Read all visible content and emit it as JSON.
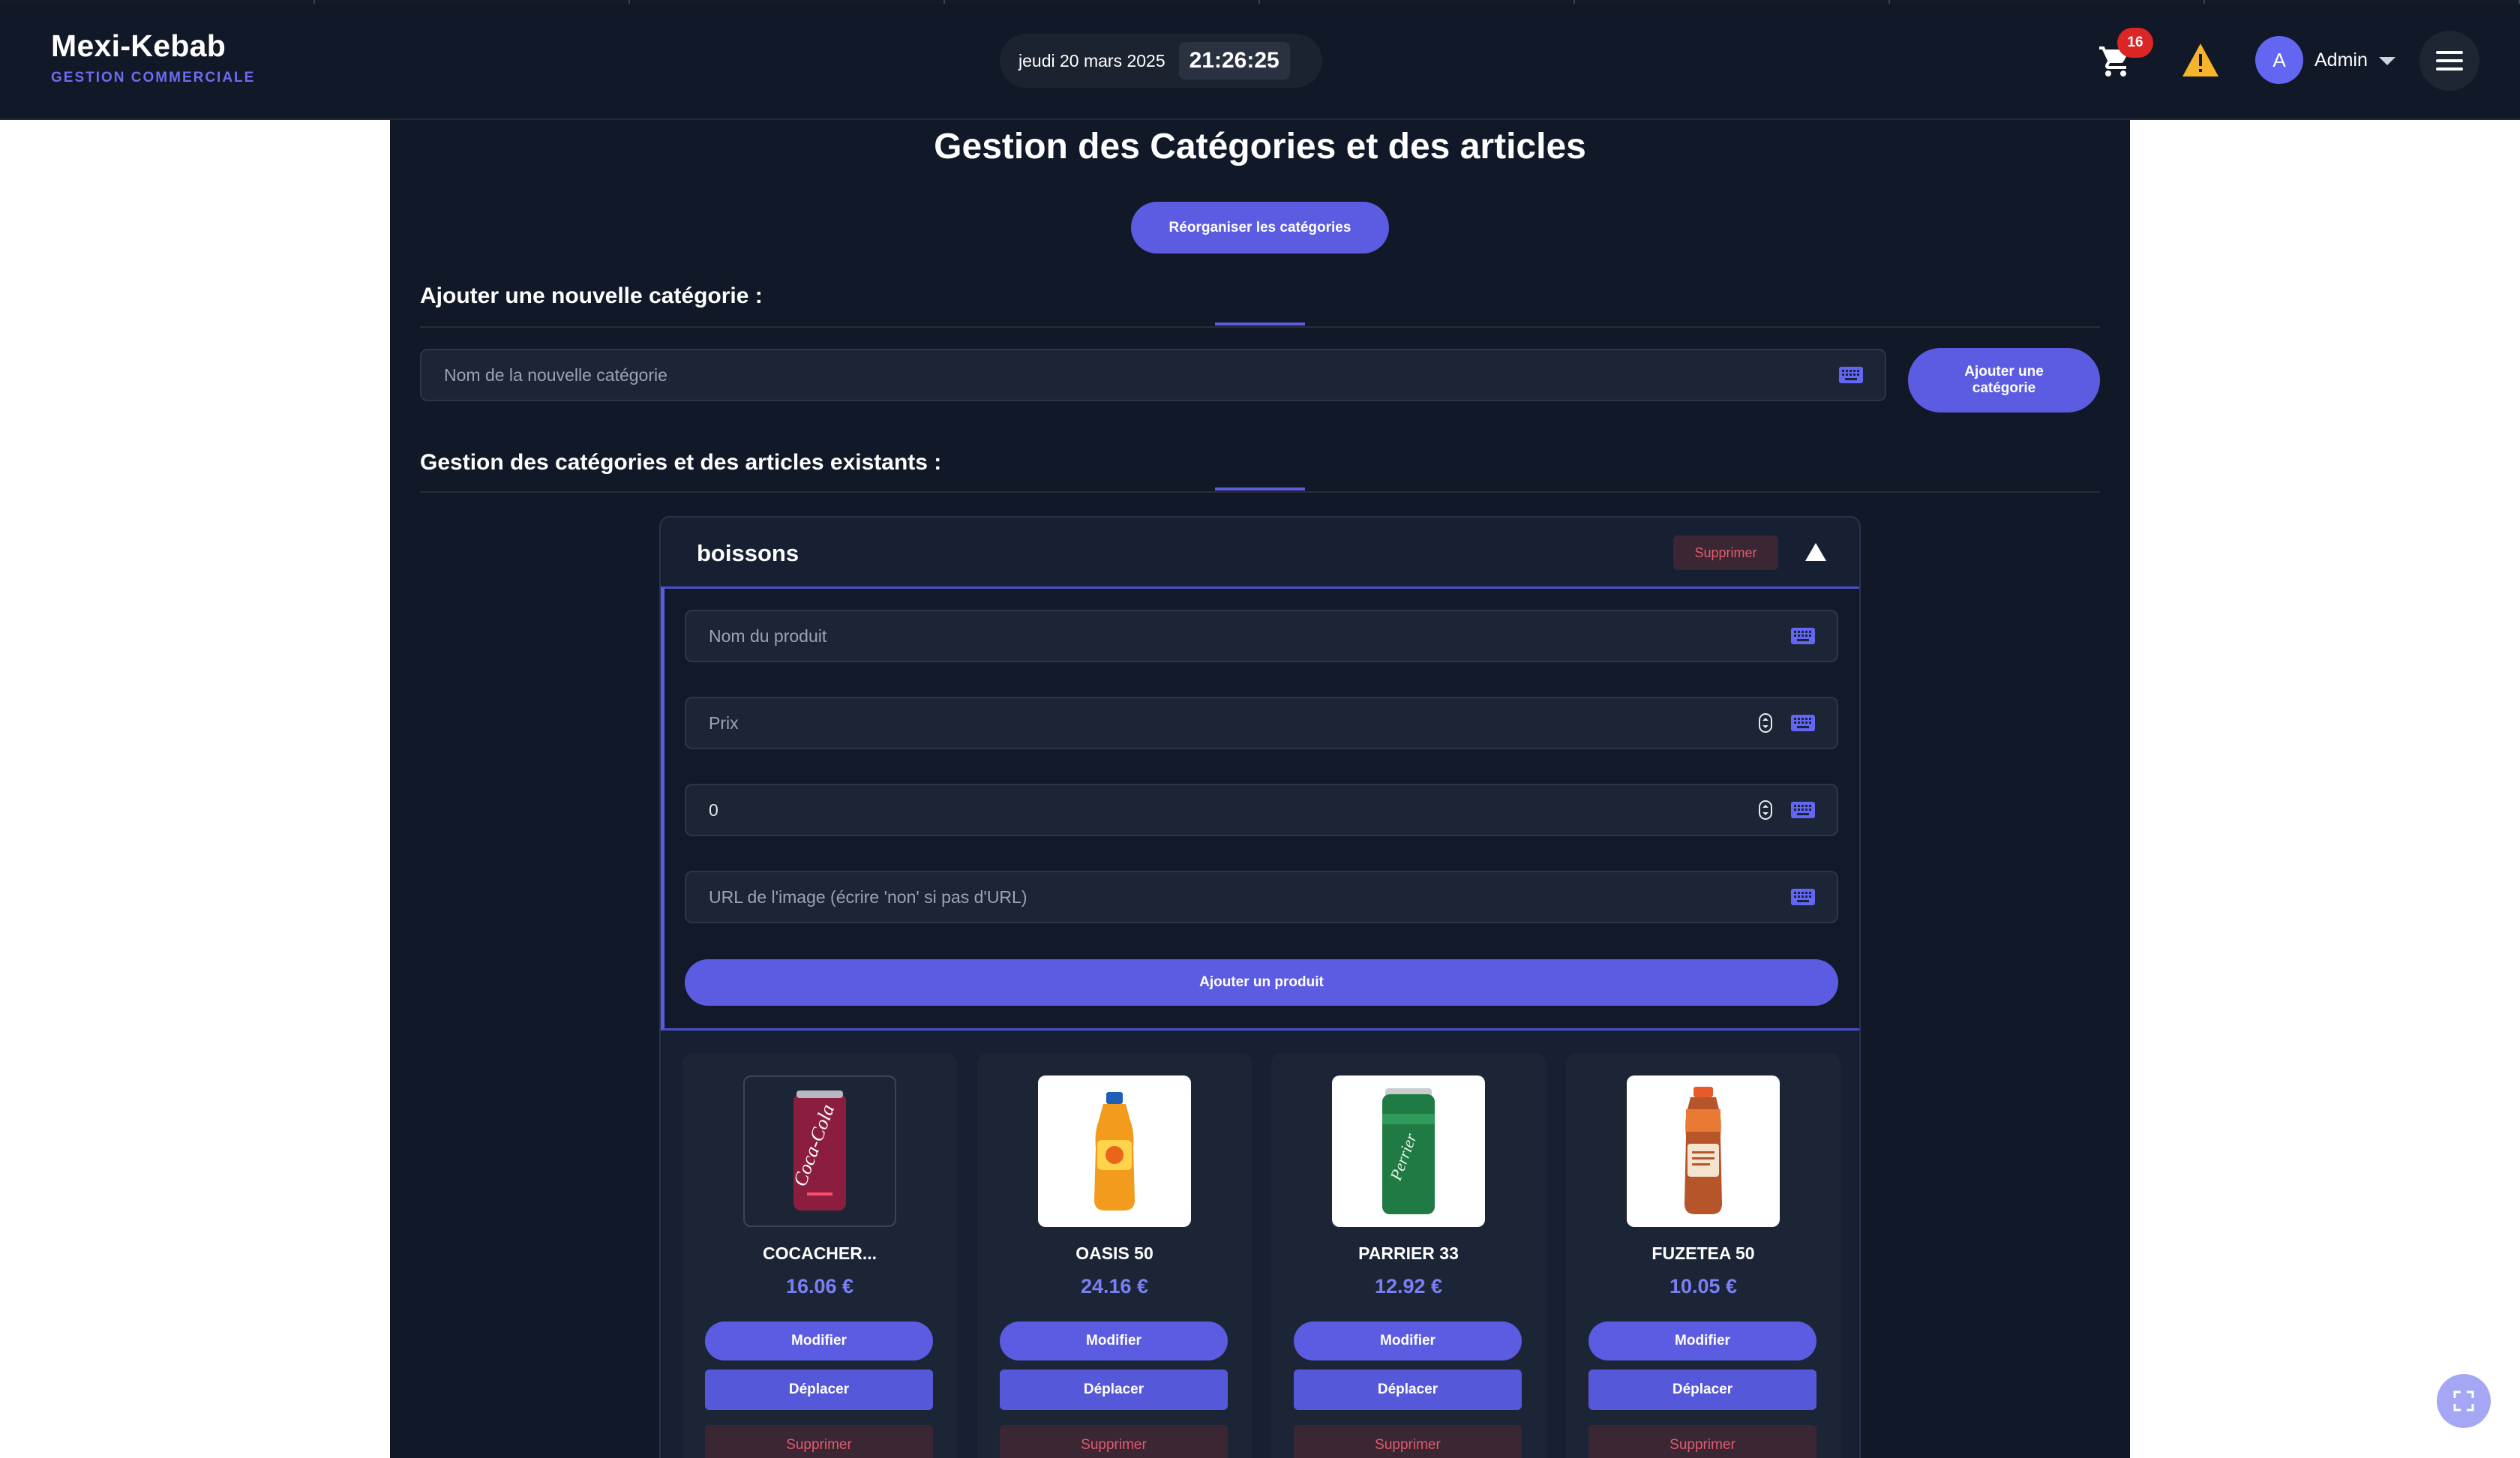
{
  "header": {
    "brand_name": "Mexi-Kebab",
    "brand_sub": "GESTION COMMERCIALE",
    "date": "jeudi 20 mars 2025",
    "time": "21:26:25",
    "cart_count": "16",
    "user_initial": "A",
    "user_name": "Admin",
    "icons": [
      "cart-icon",
      "warning-icon",
      "chevron-down-icon",
      "menu-icon"
    ]
  },
  "page": {
    "title": "Gestion des Catégories et des articles",
    "reorganize_label": "Réorganiser les catégories"
  },
  "new_category": {
    "section_title": "Ajouter une nouvelle catégorie :",
    "placeholder": "Nom de la nouvelle catégorie",
    "button_label": "Ajouter une catégorie"
  },
  "existing": {
    "section_title": "Gestion des catégories et des articles existants :"
  },
  "category": {
    "name": "boissons",
    "delete_label": "Supprimer",
    "form": {
      "product_name_placeholder": "Nom du produit",
      "price_placeholder": "Prix",
      "third_value": "0",
      "image_url_placeholder": "URL de l'image (écrire 'non' si pas d'URL)",
      "add_button_label": "Ajouter un produit"
    },
    "products": [
      {
        "name": "COCACHER...",
        "price": "16.06 €",
        "modify": "Modifier",
        "move": "Déplacer",
        "delete": "Supprimer",
        "image": "cola-can"
      },
      {
        "name": "OASIS 50",
        "price": "24.16 €",
        "modify": "Modifier",
        "move": "Déplacer",
        "delete": "Supprimer",
        "image": "orange-bottle"
      },
      {
        "name": "PARRIER 33",
        "price": "12.92 €",
        "modify": "Modifier",
        "move": "Déplacer",
        "delete": "Supprimer",
        "image": "green-can"
      },
      {
        "name": "FUZETEA 50",
        "price": "10.05 €",
        "modify": "Modifier",
        "move": "Déplacer",
        "delete": "Supprimer",
        "image": "tea-bottle"
      }
    ]
  },
  "colors": {
    "accent": "#5b5ce2",
    "background": "#111827",
    "danger": "#e05b6d"
  }
}
